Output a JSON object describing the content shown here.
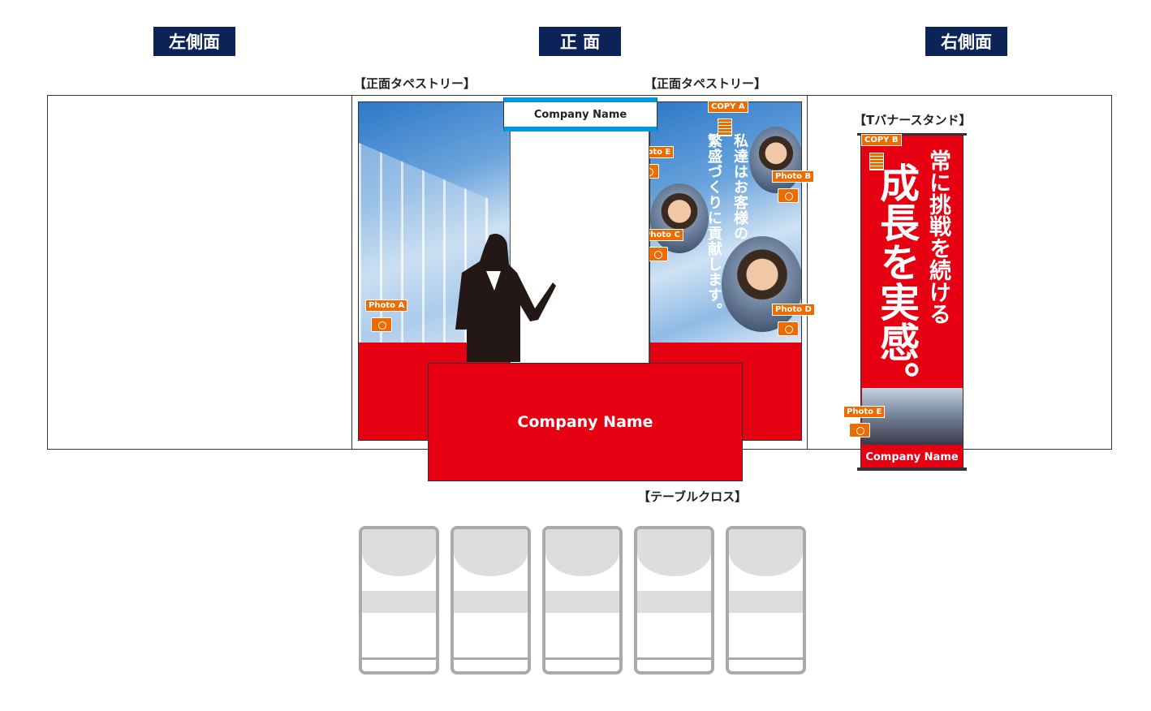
{
  "headers": {
    "left": "左側面",
    "front": "正 面",
    "right": "右側面"
  },
  "labels": {
    "tapestry_left": "【正面タペストリー】",
    "tapestry_right": "【正面タペストリー】",
    "banner_stand": "【Tバナースタンド】",
    "table_cloth": "【テーブルクロス】"
  },
  "front": {
    "sign_company": "Company Name",
    "table_company": "Company Name",
    "copy_line1": "私達はお客様の",
    "copy_line2": "繁盛づくりに貢献します。",
    "tags": {
      "copy_a": "COPY A",
      "photo_a": "Photo A",
      "photo_b": "Photo B",
      "photo_c": "Photo C",
      "photo_d": "Photo D",
      "photo_e": "Photo E"
    }
  },
  "banner": {
    "tag_copy": "COPY B",
    "tag_photo": "Photo E",
    "sub_copy": "常に挑戦を続ける",
    "main_copy": "成長を実感。",
    "company": "Company Name"
  },
  "colors": {
    "navy": "#0b2357",
    "red": "#e60012",
    "orange": "#ee6b00",
    "blue": "#0099e0"
  },
  "chairs": 5
}
